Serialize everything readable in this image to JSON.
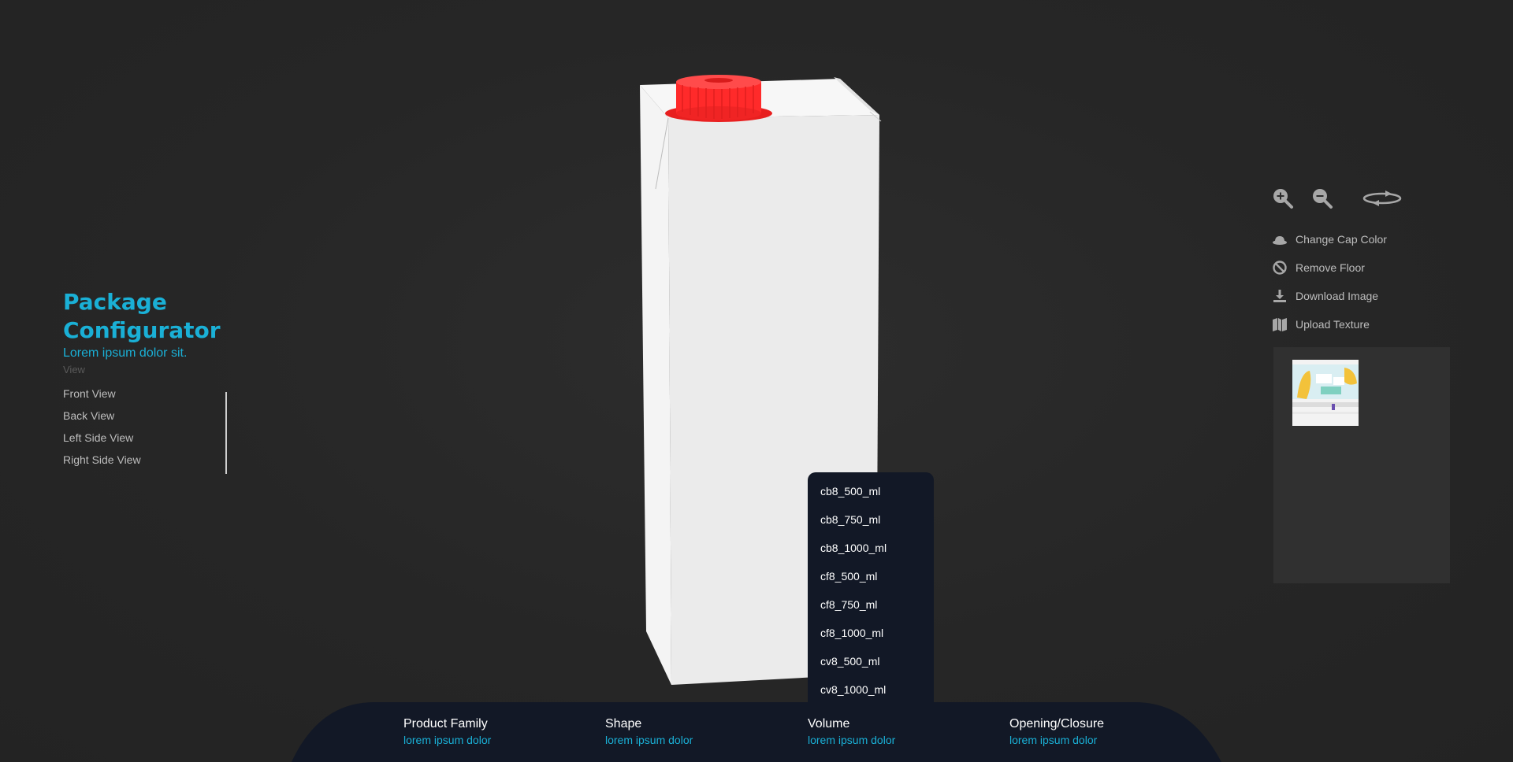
{
  "app": {
    "title": "Package Configurator",
    "subtitle": "Lorem ipsum dolor sit.",
    "view_label": "View"
  },
  "views": [
    "Front View",
    "Back View",
    "Left Side View",
    "Right Side View"
  ],
  "tools": {
    "icons": [
      "zoom-in-icon",
      "zoom-out-icon",
      "rotate-icon"
    ],
    "actions": [
      {
        "label": "Change Cap Color",
        "icon": "cap-icon"
      },
      {
        "label": "Remove Floor",
        "icon": "ban-icon"
      },
      {
        "label": "Download Image",
        "icon": "download-icon"
      },
      {
        "label": "Upload Texture",
        "icon": "map-icon"
      }
    ]
  },
  "volume_options": [
    "cb8_500_ml",
    "cb8_750_ml",
    "cb8_1000_ml",
    "cf8_500_ml",
    "cf8_750_ml",
    "cf8_1000_ml",
    "cv8_500_ml",
    "cv8_1000_ml"
  ],
  "bottom": [
    {
      "title": "Product Family",
      "value": "lorem ipsum dolor"
    },
    {
      "title": "Shape",
      "value": "lorem ipsum dolor"
    },
    {
      "title": "Volume",
      "value": "lorem ipsum dolor"
    },
    {
      "title": "Opening/Closure",
      "value": "lorem ipsum dolor"
    }
  ],
  "colors": {
    "accent": "#1ab0d6",
    "cap": "#ff2a2a",
    "dropdown_bg": "#121826",
    "background": "#262626"
  }
}
